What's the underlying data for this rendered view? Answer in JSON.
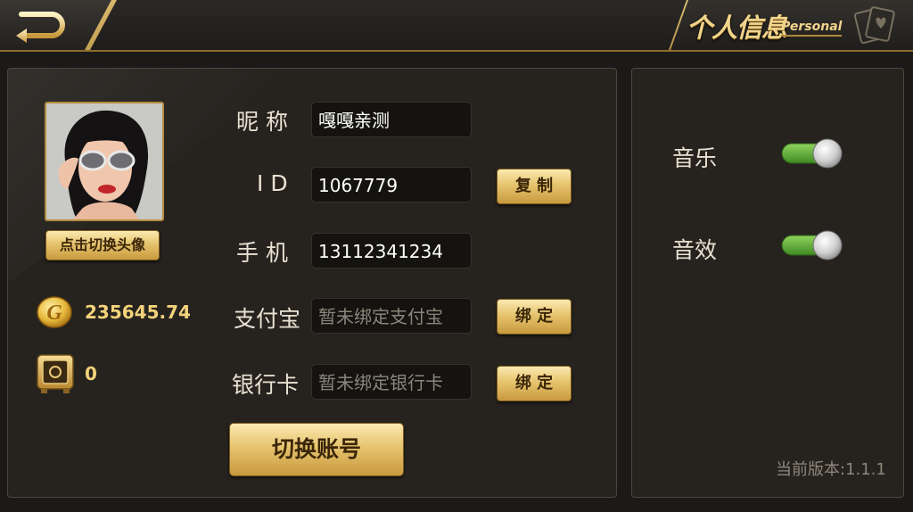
{
  "header": {
    "back_icon": "back-arrow-icon",
    "title_cn": "个人信息",
    "title_en": "Personal",
    "title_decoration_icon": "playing-cards-icon",
    "accent": "#f1d48c"
  },
  "profile": {
    "avatar_icon": "avatar-photo",
    "change_avatar_label": "点击切换头像",
    "coins": "235645.74",
    "coin_icon": "gold-coin-icon",
    "safe_value": "0",
    "safe_icon": "safe-box-icon"
  },
  "form": {
    "nickname_label": "昵 称",
    "nickname_value": "嘎嘎亲测",
    "id_label": "I D",
    "id_value": "1067779",
    "copy_label": "复 制",
    "phone_label": "手 机",
    "phone_value": "13112341234",
    "alipay_label": "支付宝",
    "alipay_placeholder": "暂未绑定支付宝",
    "alipay_bind_label": "绑 定",
    "bank_label": "银行卡",
    "bank_placeholder": "暂未绑定银行卡",
    "bank_bind_label": "绑 定",
    "switch_account_label": "切换账号"
  },
  "settings": {
    "music_label": "音乐",
    "music_on": true,
    "sfx_label": "音效",
    "sfx_on": true,
    "toggle_on_color": "#5fae3a",
    "version_text": "当前版本:1.1.1"
  }
}
